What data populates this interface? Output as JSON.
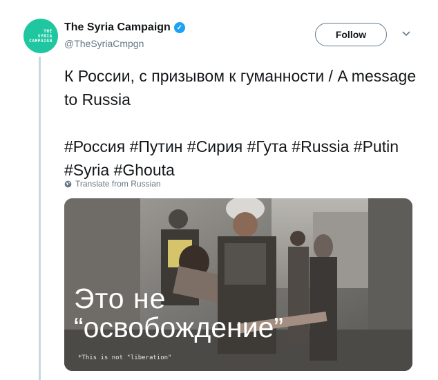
{
  "tweet": {
    "avatar_text": [
      "THE",
      "SYRIA",
      "CAMPAIGN"
    ],
    "author_name": "The Syria Campaign",
    "author_handle": "@TheSyriaCmpgn",
    "follow_label": "Follow",
    "text_line1": "К России, с призывом к гуманности / A message to Russia",
    "text_line2": "#Россия #Путин #Сирия #Гута #Russia #Putin #Syria #Ghouta",
    "translate_label": "Translate from Russian",
    "media": {
      "overlay_line1": "Это не",
      "overlay_line2": "“освобождение”",
      "caption": "*This is not \"liberation\""
    }
  },
  "colors": {
    "avatar": "#1fc7a1",
    "verified": "#1da1f2",
    "secondary_text": "#657786"
  },
  "icons": {
    "verified": "verified-badge-icon",
    "caret": "chevron-down-icon",
    "globe": "globe-icon"
  }
}
